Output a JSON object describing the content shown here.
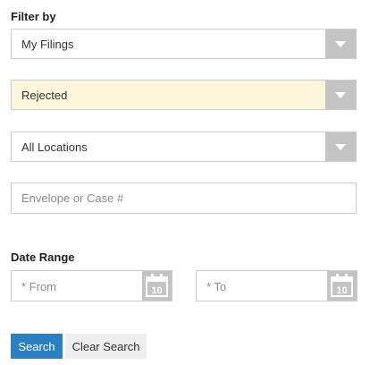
{
  "filter": {
    "heading": "Filter by",
    "filing_scope": {
      "value": "My Filings"
    },
    "status": {
      "value": "Rejected"
    },
    "location": {
      "value": "All Locations"
    },
    "search": {
      "placeholder": "Envelope or Case #"
    }
  },
  "date_range": {
    "heading": "Date Range",
    "from_placeholder": "* From",
    "to_placeholder": "* To",
    "calendar_day": "10"
  },
  "actions": {
    "search_label": "Search",
    "clear_label": "Clear Search"
  },
  "colors": {
    "primary": "#2a80c2",
    "highlight_bg": "#fdf6dc",
    "arrow_box": "#c4c4c4"
  },
  "icons": {
    "dropdown": "chevron-down-icon",
    "calendar": "calendar-icon"
  }
}
